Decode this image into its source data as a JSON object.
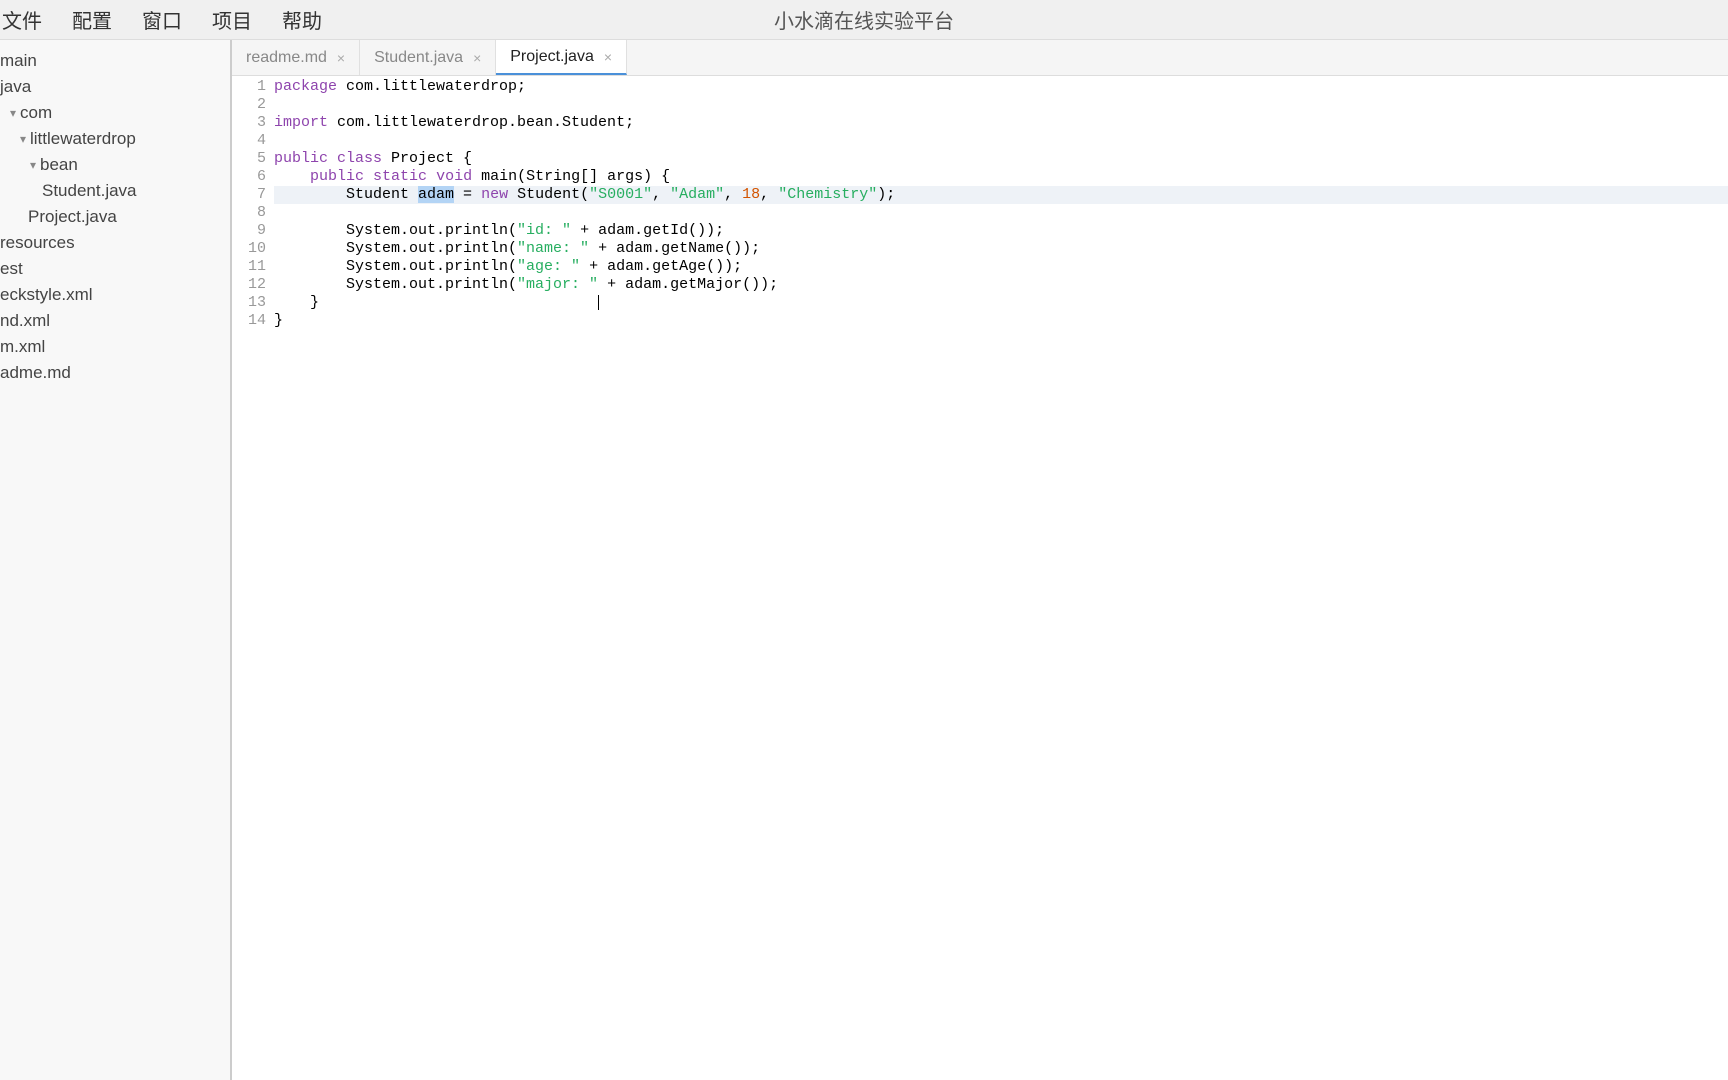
{
  "menubar": {
    "items": [
      "文件",
      "配置",
      "窗口",
      "项目",
      "帮助"
    ],
    "title": "小水滴在线实验平台"
  },
  "sidebar": {
    "tree": [
      {
        "label": "main",
        "indent": 0,
        "caret": ""
      },
      {
        "label": "java",
        "indent": 0,
        "caret": ""
      },
      {
        "label": "com",
        "indent": 1,
        "caret": "▾"
      },
      {
        "label": "littlewaterdrop",
        "indent": 2,
        "caret": "▾"
      },
      {
        "label": "bean",
        "indent": 3,
        "caret": "▾"
      },
      {
        "label": "Student.java",
        "indent": 4,
        "caret": ""
      },
      {
        "label": "Project.java",
        "indent": 3,
        "caret": ""
      },
      {
        "label": "resources",
        "indent": 0,
        "caret": ""
      },
      {
        "label": "est",
        "indent": 0,
        "caret": ""
      },
      {
        "label": "eckstyle.xml",
        "indent": 0,
        "caret": ""
      },
      {
        "label": "nd.xml",
        "indent": 0,
        "caret": ""
      },
      {
        "label": "m.xml",
        "indent": 0,
        "caret": ""
      },
      {
        "label": "adme.md",
        "indent": 0,
        "caret": ""
      }
    ]
  },
  "tabs": [
    {
      "label": "readme.md",
      "active": false
    },
    {
      "label": "Student.java",
      "active": false
    },
    {
      "label": "Project.java",
      "active": true
    }
  ],
  "code": {
    "lines": [
      {
        "n": 1,
        "tokens": [
          {
            "t": "package",
            "c": "kw"
          },
          {
            "t": " com.littlewaterdrop;",
            "c": ""
          }
        ]
      },
      {
        "n": 2,
        "tokens": []
      },
      {
        "n": 3,
        "tokens": [
          {
            "t": "import",
            "c": "kw"
          },
          {
            "t": " com.littlewaterdrop.bean.Student;",
            "c": ""
          }
        ]
      },
      {
        "n": 4,
        "tokens": []
      },
      {
        "n": 5,
        "tokens": [
          {
            "t": "public",
            "c": "kw"
          },
          {
            "t": " ",
            "c": ""
          },
          {
            "t": "class",
            "c": "kw"
          },
          {
            "t": " Project {",
            "c": ""
          }
        ]
      },
      {
        "n": 6,
        "tokens": [
          {
            "t": "    ",
            "c": ""
          },
          {
            "t": "public",
            "c": "kw"
          },
          {
            "t": " ",
            "c": ""
          },
          {
            "t": "static",
            "c": "kw"
          },
          {
            "t": " ",
            "c": ""
          },
          {
            "t": "void",
            "c": "kw"
          },
          {
            "t": " main(String[] args) {",
            "c": ""
          }
        ]
      },
      {
        "n": 7,
        "current": true,
        "tokens": [
          {
            "t": "        Student ",
            "c": ""
          },
          {
            "t": "adam",
            "c": "sel"
          },
          {
            "t": " = ",
            "c": ""
          },
          {
            "t": "new",
            "c": "kw"
          },
          {
            "t": " Student(",
            "c": ""
          },
          {
            "t": "\"S0001\"",
            "c": "str"
          },
          {
            "t": ", ",
            "c": ""
          },
          {
            "t": "\"Adam\"",
            "c": "str"
          },
          {
            "t": ", ",
            "c": ""
          },
          {
            "t": "18",
            "c": "num"
          },
          {
            "t": ", ",
            "c": ""
          },
          {
            "t": "\"Chemistry\"",
            "c": "str"
          },
          {
            "t": ");",
            "c": ""
          }
        ]
      },
      {
        "n": 8,
        "tokens": []
      },
      {
        "n": 9,
        "tokens": [
          {
            "t": "        System.out.println(",
            "c": ""
          },
          {
            "t": "\"id: \"",
            "c": "str"
          },
          {
            "t": " + adam.getId());",
            "c": ""
          }
        ]
      },
      {
        "n": 10,
        "tokens": [
          {
            "t": "        System.out.println(",
            "c": ""
          },
          {
            "t": "\"name: \"",
            "c": "str"
          },
          {
            "t": " + adam.getName());",
            "c": ""
          }
        ]
      },
      {
        "n": 11,
        "tokens": [
          {
            "t": "        System.out.println(",
            "c": ""
          },
          {
            "t": "\"age: \"",
            "c": "str"
          },
          {
            "t": " + adam.getAge());",
            "c": ""
          }
        ]
      },
      {
        "n": 12,
        "tokens": [
          {
            "t": "        System.out.println(",
            "c": ""
          },
          {
            "t": "\"major: \"",
            "c": "str"
          },
          {
            "t": " + adam.getMajor());",
            "c": ""
          }
        ]
      },
      {
        "n": 13,
        "tokens": [
          {
            "t": "    }",
            "c": ""
          },
          {
            "t": "                               ",
            "c": ""
          },
          {
            "t": "",
            "c": "cursor"
          }
        ]
      },
      {
        "n": 14,
        "tokens": [
          {
            "t": "}",
            "c": ""
          }
        ]
      }
    ]
  }
}
